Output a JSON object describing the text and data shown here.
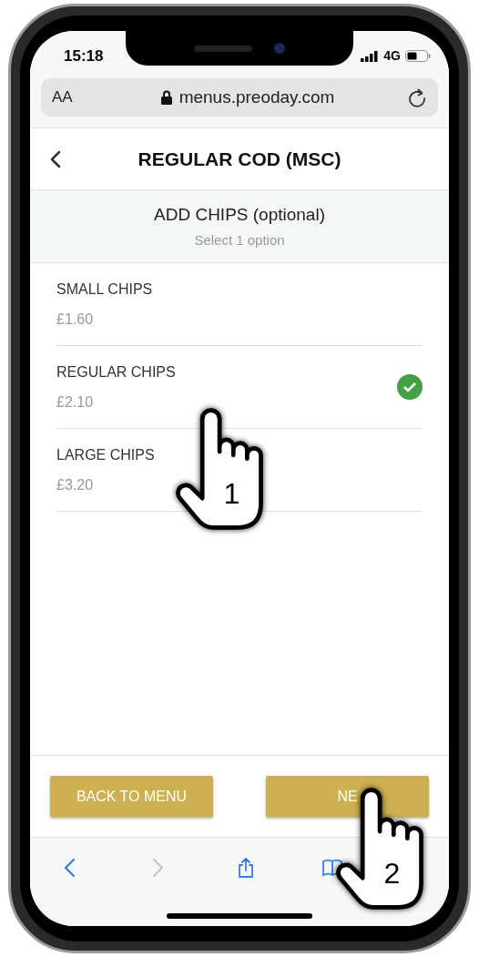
{
  "status_bar": {
    "time": "15:18",
    "network": "4G"
  },
  "browser": {
    "text_size": "AA",
    "url": "menus.preoday.com"
  },
  "header": {
    "title": "REGULAR COD (MSC)"
  },
  "section": {
    "title": "ADD CHIPS (optional)",
    "subtitle": "Select 1 option"
  },
  "options": [
    {
      "name": "SMALL CHIPS",
      "price": "£1.60",
      "selected": false
    },
    {
      "name": "REGULAR CHIPS",
      "price": "£2.10",
      "selected": true
    },
    {
      "name": "LARGE CHIPS",
      "price": "£3.20",
      "selected": false
    }
  ],
  "buttons": [
    {
      "label": "BACK TO MENU"
    },
    {
      "label": "NE"
    }
  ],
  "toolbar": [
    {
      "kind": "back",
      "disabled": false
    },
    {
      "kind": "forward",
      "disabled": true
    },
    {
      "kind": "share",
      "disabled": false
    },
    {
      "kind": "bookmarks",
      "disabled": false
    }
  ],
  "annotations": [
    {
      "label": "1"
    },
    {
      "label": "2"
    }
  ]
}
